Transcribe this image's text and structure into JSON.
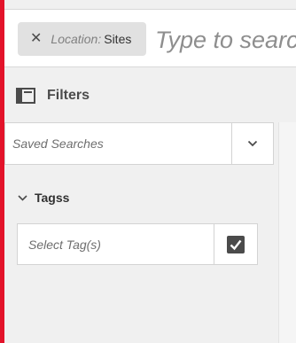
{
  "colors": {
    "accent": "#e3132a",
    "panel_bg": "#f0f0f0",
    "field_bg": "#ffffff",
    "tag_bg": "#e1e1e1",
    "checkbox": "#4b4b4b"
  },
  "topbar": {
    "location_tag": {
      "close_icon": "close-icon",
      "key": "Location:",
      "value": "Sites"
    },
    "search": {
      "placeholder": "Type to search",
      "value": ""
    }
  },
  "filters": {
    "icon": "filters-rail-icon",
    "title": "Filters",
    "saved_searches": {
      "label": "Saved Searches",
      "icon": "chevron-down-icon"
    },
    "tags": {
      "label": "Tagss",
      "icon": "chevron-down-icon",
      "picker": {
        "placeholder": "Select Tag(s)",
        "value": "",
        "button_icon": "checkbox-checked-icon"
      }
    }
  }
}
